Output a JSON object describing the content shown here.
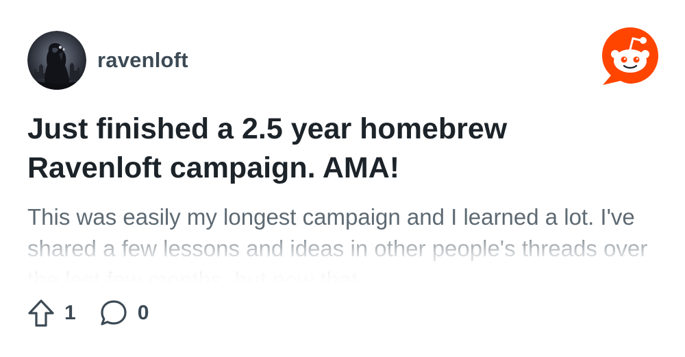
{
  "post": {
    "username": "ravenloft",
    "title": "Just finished a 2.5 year homebrew Ravenloft campaign. AMA!",
    "body": "This was easily my longest campaign and I learned a lot. I've shared a few lessons and ideas in other people's threads over the last few months, but now that"
  },
  "stats": {
    "upvotes": "1",
    "comments": "0"
  },
  "icons": {
    "upvote": "arrow-up-outline-icon",
    "comment": "speech-bubble-icon",
    "brand": "reddit-snoo-logo",
    "avatar": "gothic-castle-figure-avatar"
  },
  "colors": {
    "brand": "#ff4500",
    "title": "#1c2329",
    "meta": "#3c4a55",
    "body": "#5e6a73"
  }
}
